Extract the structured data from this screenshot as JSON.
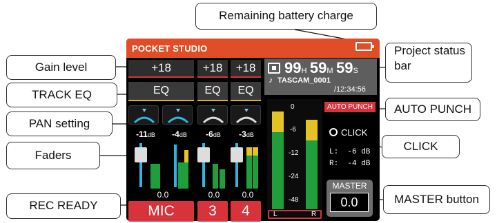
{
  "app_title": "POCKET STUDIO",
  "callouts": {
    "battery": "Remaining battery charge",
    "gain": "Gain level",
    "eq": "TRACK EQ",
    "pan": "PAN setting",
    "faders": "Faders",
    "rec": "REC READY",
    "status_line1": "Project status",
    "status_line2": "bar",
    "autopunch": "AUTO PUNCH",
    "click": "CLICK",
    "master": "MASTER button"
  },
  "tracks": [
    {
      "gain": "+18",
      "eq": "EQ",
      "level": "-11",
      "level_unit": "dB",
      "label": "MIC"
    },
    {
      "level": "-4",
      "level_unit": "dB"
    },
    {
      "gain": "+18",
      "eq": "EQ",
      "level": "-6",
      "level_unit": "dB",
      "label": "3"
    },
    {
      "gain": "+18",
      "eq": "EQ",
      "level": "-3",
      "level_unit": "dB",
      "label": "4"
    }
  ],
  "fader_value": "0.0",
  "status": {
    "hours": "99",
    "hours_unit": "H",
    "minutes": "59",
    "minutes_unit": "M",
    "seconds": "59",
    "seconds_unit": "S",
    "project": "TASCAM_0001",
    "total": "/12:34:56"
  },
  "meter_ticks": [
    "0",
    "-6",
    "-12",
    "-24",
    "-48"
  ],
  "meter_lr": [
    "L",
    "R"
  ],
  "autopunch_label": "AUTO PUNCH",
  "click_label": "CLICK",
  "click_levels": [
    "L:  -6 dB",
    "R:  -4 dB"
  ],
  "master_label": "MASTER",
  "master_value": "0.0"
}
